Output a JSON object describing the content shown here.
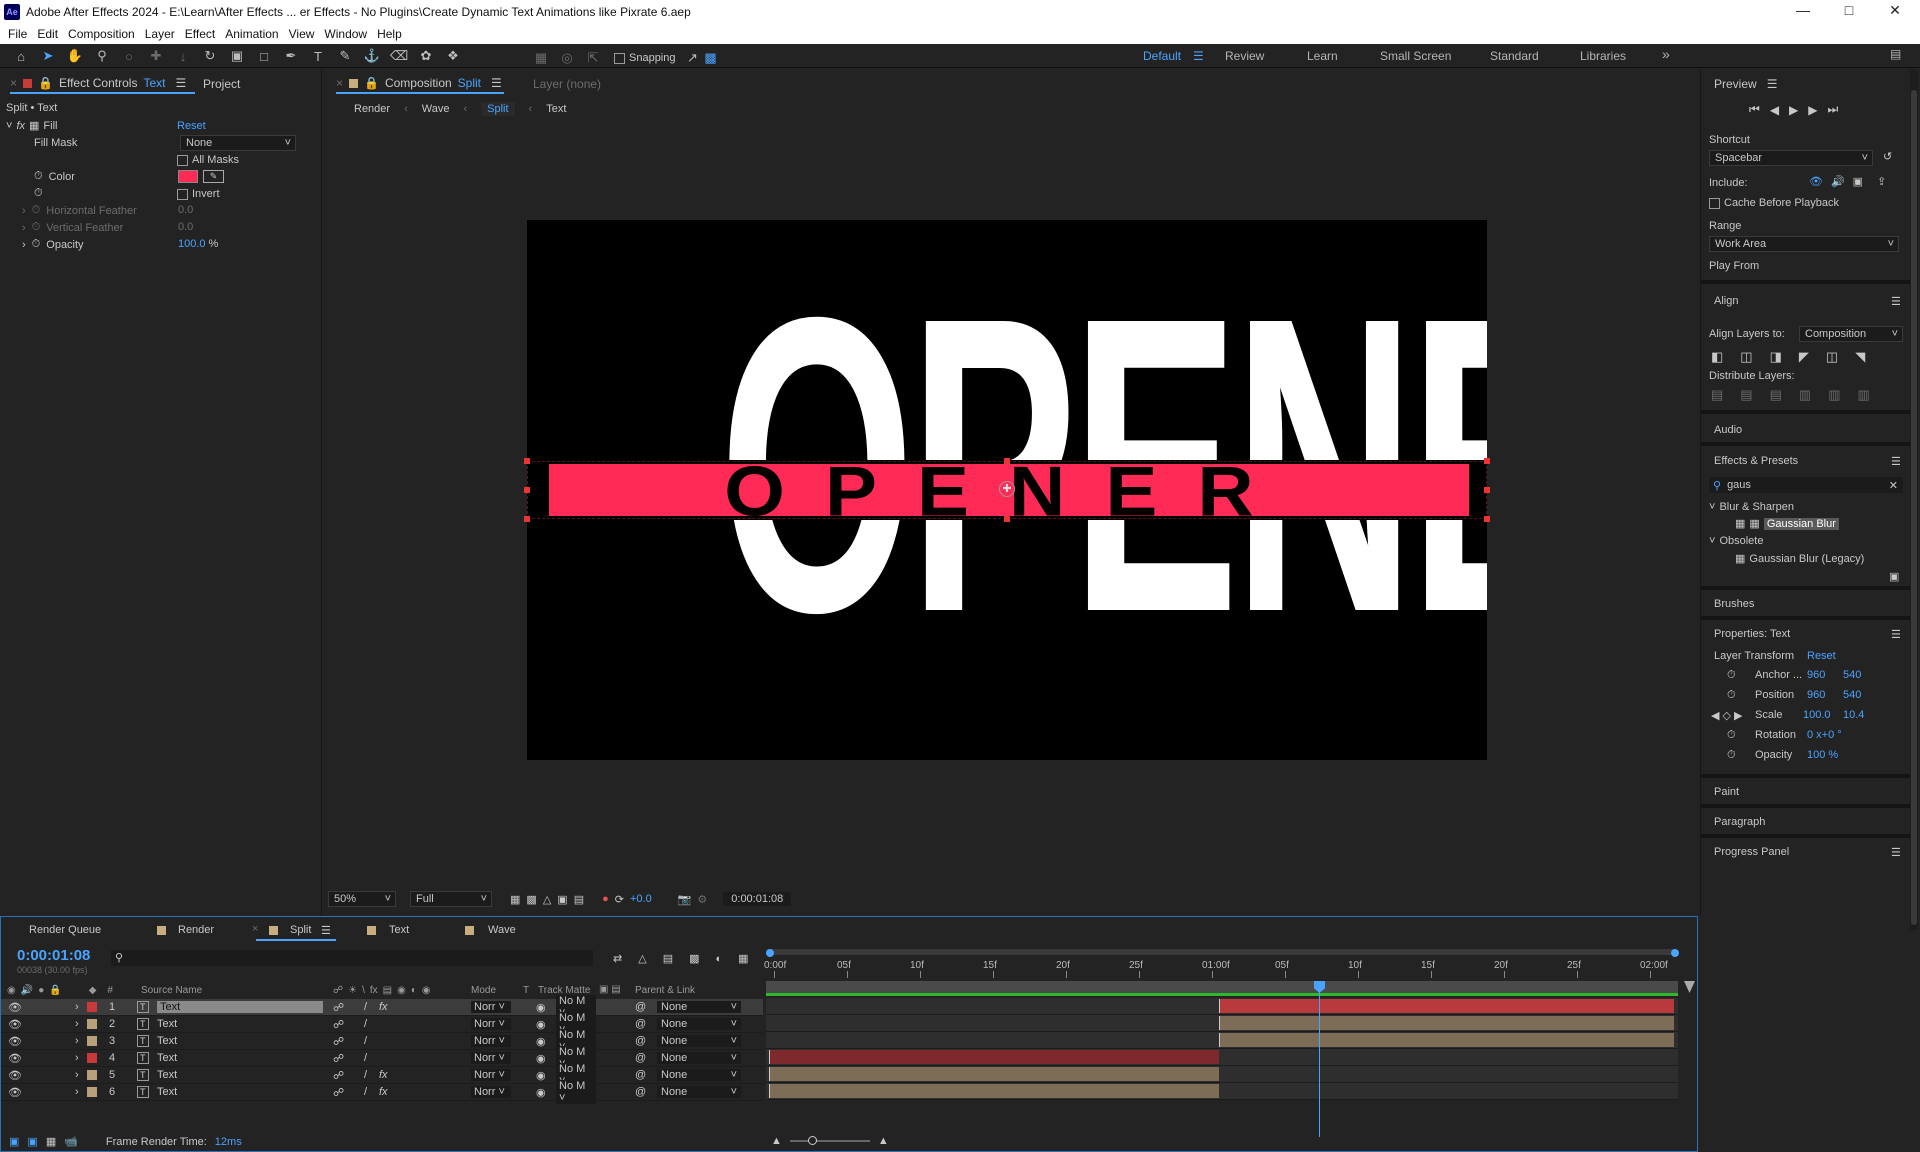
{
  "window": {
    "title": "Adobe After Effects 2024 - E:\\Learn\\After Effects ... er Effects - No Plugins\\Create Dynamic Text Animations like Pixrate 6.aep",
    "logo": "Ae"
  },
  "menu": [
    "File",
    "Edit",
    "Composition",
    "Layer",
    "Effect",
    "Animation",
    "View",
    "Window",
    "Help"
  ],
  "toolbar": {
    "snapping": "Snapping"
  },
  "workspaces": [
    "Default",
    "Review",
    "Learn",
    "Small Screen",
    "Standard",
    "Libraries"
  ],
  "effect_controls": {
    "tab_label": "Effect Controls",
    "tab_target": "Text",
    "project_tab": "Project",
    "layer_path": "Split • Text",
    "effect_name": "Fill",
    "reset": "Reset",
    "fill_mask_label": "Fill Mask",
    "fill_mask_value": "None",
    "all_masks": "All Masks",
    "color_label": "Color",
    "color_value": "#ff2a55",
    "invert": "Invert",
    "h_feather": "Horizontal Feather",
    "h_feather_val": "0.0",
    "v_feather": "Vertical Feather",
    "v_feather_val": "0.0",
    "opacity_label": "Opacity",
    "opacity_val": "100.0",
    "opacity_unit": "%"
  },
  "composition": {
    "tab_label": "Composition",
    "tab_target": "Split",
    "layer_tab": "Layer (none)",
    "breadcrumbs": [
      "Render",
      "Wave",
      "Split",
      "Text"
    ],
    "big_top": "OPENER",
    "band_text": "OPENER",
    "big_bottom": "OPENER",
    "zoom": "50%",
    "quality": "Full",
    "exposure": "+0.0",
    "timecode": "0:00:01:08"
  },
  "preview": {
    "title": "Preview",
    "shortcut_label": "Shortcut",
    "shortcut_value": "Spacebar",
    "include": "Include:",
    "cache": "Cache Before Playback",
    "range_label": "Range",
    "range_value": "Work Area",
    "play_from": "Play From"
  },
  "align": {
    "title": "Align",
    "align_to_label": "Align Layers to:",
    "align_to_value": "Composition",
    "distribute": "Distribute Layers:"
  },
  "audio": {
    "title": "Audio"
  },
  "effects_presets": {
    "title": "Effects & Presets",
    "search": "gaus",
    "groups": [
      {
        "name": "Blur & Sharpen",
        "items": [
          "Gaussian Blur"
        ]
      },
      {
        "name": "Obsolete",
        "items": [
          "Gaussian Blur (Legacy)"
        ]
      }
    ]
  },
  "brushes": {
    "title": "Brushes"
  },
  "properties": {
    "title": "Properties: Text",
    "layer_transform": "Layer Transform",
    "reset": "Reset",
    "rows": [
      {
        "label": "Anchor ...",
        "v1": "960",
        "v2": "540"
      },
      {
        "label": "Position",
        "v1": "960",
        "v2": "540"
      },
      {
        "label": "Scale",
        "v1": "100.0",
        "v2": "10.4"
      },
      {
        "label": "Rotation",
        "v1": "0 x+0 °",
        "v2": ""
      },
      {
        "label": "Opacity",
        "v1": "100 %",
        "v2": ""
      }
    ]
  },
  "side_sections": [
    "Paint",
    "Paragraph",
    "Progress Panel"
  ],
  "timeline": {
    "tabs": [
      "Render Queue",
      "Render",
      "Split",
      "Text",
      "Wave"
    ],
    "timecode": "0:00:01:08",
    "fps": "00038 (30.00 fps)",
    "columns": {
      "source": "Source Name",
      "mode": "Mode",
      "t": "T",
      "track": "Track Matte",
      "parent": "Parent & Link",
      "num": "#"
    },
    "ruler": [
      "0:00f",
      "05f",
      "10f",
      "15f",
      "20f",
      "25f",
      "01:00f",
      "05f",
      "10f",
      "15f",
      "20f",
      "25f",
      "02:00f"
    ],
    "layers": [
      {
        "num": "1",
        "name": "Text",
        "color": "#c83a3a",
        "mode": "Norr",
        "track": "No M",
        "parent": "None",
        "fx": true
      },
      {
        "num": "2",
        "name": "Text",
        "color": "#b8a07a",
        "mode": "Norr",
        "track": "No M",
        "parent": "None",
        "fx": false
      },
      {
        "num": "3",
        "name": "Text",
        "color": "#b8a07a",
        "mode": "Norr",
        "track": "No M",
        "parent": "None",
        "fx": false
      },
      {
        "num": "4",
        "name": "Text",
        "color": "#c83a3a",
        "mode": "Norr",
        "track": "No M",
        "parent": "None",
        "fx": false
      },
      {
        "num": "5",
        "name": "Text",
        "color": "#b8a07a",
        "mode": "Norr",
        "track": "No M",
        "parent": "None",
        "fx": true
      },
      {
        "num": "6",
        "name": "Text",
        "color": "#b8a07a",
        "mode": "Norr",
        "track": "No M",
        "parent": "None",
        "fx": true
      }
    ],
    "frame_render_label": "Frame Render Time:",
    "frame_render_value": "12ms"
  }
}
